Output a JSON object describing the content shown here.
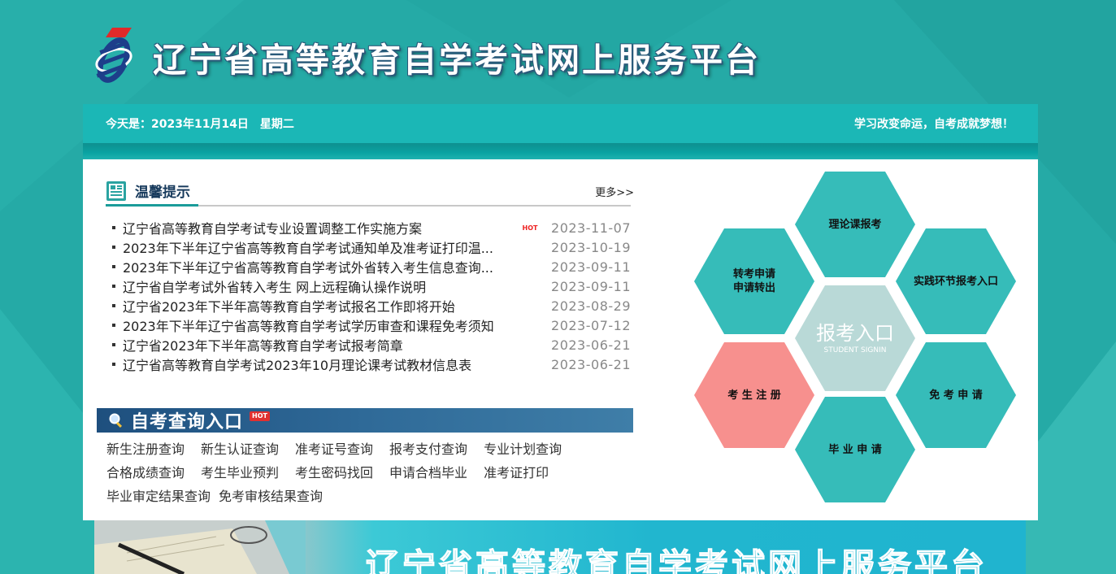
{
  "header": {
    "site_title": "辽宁省高等教育自学考试网上服务平台"
  },
  "datebar": {
    "date_text": "今天是：2023年11月14日　星期二",
    "slogan": "学习改变命运，自考成就梦想！"
  },
  "notice": {
    "title": "温馨提示",
    "more": "更多>>",
    "items": [
      {
        "title": "辽宁省高等教育自学考试专业设置调整工作实施方案",
        "hot": "HOT",
        "date": "2023-11-07"
      },
      {
        "title": "2023年下半年辽宁省高等教育自学考试通知单及准考证打印温...",
        "hot": "",
        "date": "2023-10-19"
      },
      {
        "title": "2023年下半年辽宁省高等教育自学考试外省转入考生信息查询...",
        "hot": "",
        "date": "2023-09-11"
      },
      {
        "title": "辽宁省自学考试外省转入考生 网上远程确认操作说明",
        "hot": "",
        "date": "2023-09-11"
      },
      {
        "title": "辽宁省2023年下半年高等教育自学考试报名工作即将开始",
        "hot": "",
        "date": "2023-08-29"
      },
      {
        "title": "2023年下半年辽宁省高等教育自学考试学历审查和课程免考须知",
        "hot": "",
        "date": "2023-07-12"
      },
      {
        "title": "辽宁省2023年下半年高等教育自学考试报考简章",
        "hot": "",
        "date": "2023-06-21"
      },
      {
        "title": "辽宁省高等教育自学考试2023年10月理论课考试教材信息表",
        "hot": "",
        "date": "2023-06-21"
      }
    ]
  },
  "query": {
    "title": "自考查询入口",
    "hot": "HOT",
    "rows": [
      [
        "新生注册查询",
        "新生认证查询",
        "准考证号查询",
        "报考支付查询",
        "专业计划查询"
      ],
      [
        "合格成绩查询",
        "考生毕业预判",
        "考生密码找回",
        "申请合档毕业",
        "准考证打印"
      ],
      [
        "毕业审定结果查询",
        "免考审核结果查询"
      ]
    ]
  },
  "hexes": {
    "theory": "理论课报考",
    "transfer_1": "转考申请",
    "transfer_2": "申请转出",
    "practice": "实践环节报考入口",
    "center_big": "报考入口",
    "center_small": "STUDENT SIGNIN",
    "register": "考 生 注 册",
    "exempt": "免 考 申 请",
    "graduate": "毕 业 申 请"
  },
  "banner": {
    "title": "辽宁省高等教育自学考试网上服务平台"
  },
  "colors": {
    "background": "#25aaa6",
    "datebar": "#1bb7b6",
    "hex_teal": "#36bcb9",
    "hex_center": "#b9d9d7",
    "hex_pink": "#f7908e",
    "query_bar": "#2f6a98"
  }
}
